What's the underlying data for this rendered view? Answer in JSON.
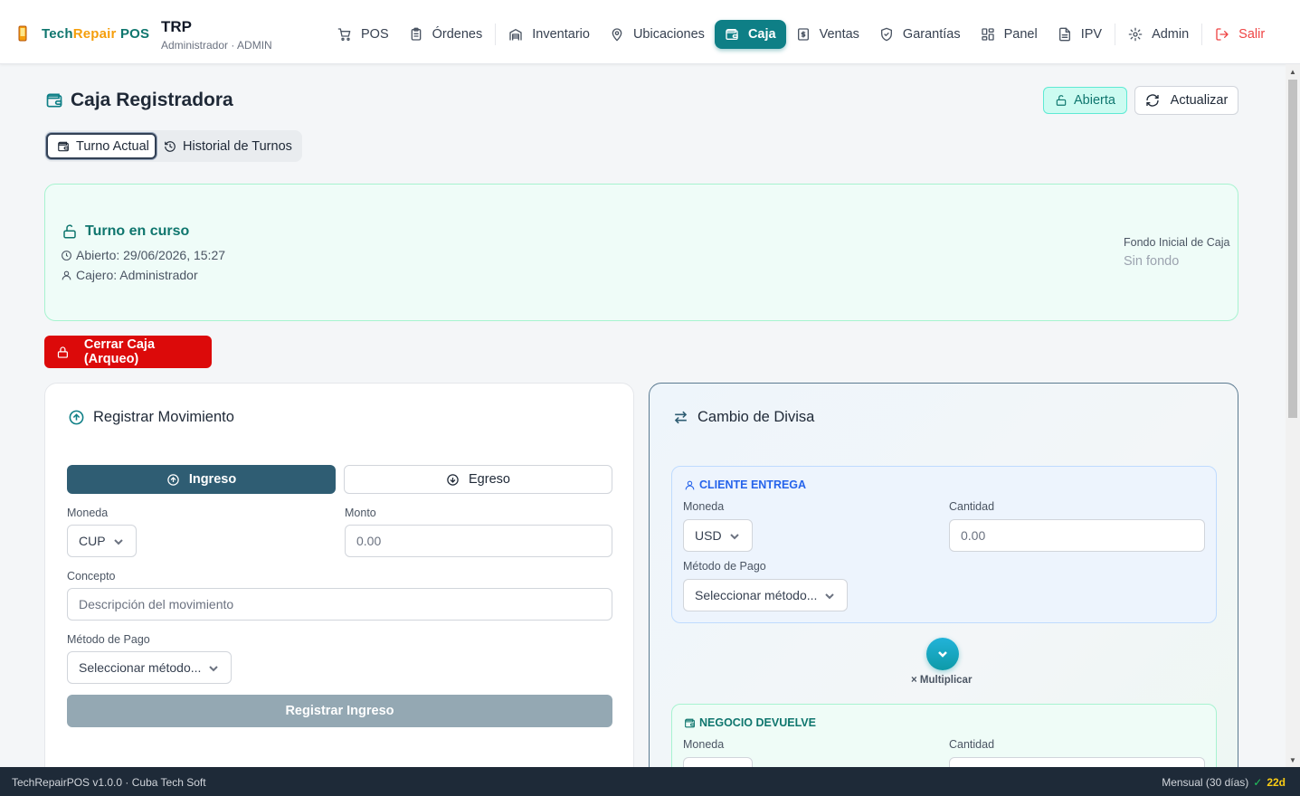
{
  "brand": {
    "name_prefix": "Tech",
    "name_accent": "Repair",
    "name_suffix": " POS",
    "store_code": "TRP",
    "user_line": "Administrador · ADMIN"
  },
  "nav": {
    "pos": "POS",
    "ordenes": "Órdenes",
    "inventario": "Inventario",
    "ubicaciones": "Ubicaciones",
    "caja": "Caja",
    "ventas": "Ventas",
    "garantias": "Garantías",
    "panel": "Panel",
    "ipv": "IPV",
    "admin": "Admin",
    "salir": "Salir"
  },
  "page": {
    "title": "Caja Registradora",
    "status": "Abierta",
    "refresh": "Actualizar"
  },
  "tabs": {
    "current": "Turno Actual",
    "history": "Historial de Turnos"
  },
  "shift": {
    "title": "Turno en curso",
    "opened": "Abierto: 29/06/2026, 15:27",
    "cashier": "Cajero: Administrador",
    "fund_label": "Fondo Inicial de Caja",
    "fund_value": "Sin fondo"
  },
  "close_button": "Cerrar Caja (Arqueo)",
  "movement": {
    "title": "Registrar Movimiento",
    "income": "Ingreso",
    "expense": "Egreso",
    "currency_label": "Moneda",
    "currency_value": "CUP",
    "amount_label": "Monto",
    "amount_placeholder": "0.00",
    "concept_label": "Concepto",
    "concept_placeholder": "Descripción del movimiento",
    "method_label": "Método de Pago",
    "method_placeholder": "Seleccionar método...",
    "submit": "Registrar Ingreso"
  },
  "exchange": {
    "title": "Cambio de Divisa",
    "client_title": "CLIENTE ENTREGA",
    "client_currency_label": "Moneda",
    "client_currency_value": "USD",
    "client_amount_label": "Cantidad",
    "client_amount_placeholder": "0.00",
    "client_method_label": "Método de Pago",
    "client_method_placeholder": "Seleccionar método...",
    "multiply_label": "× Multiplicar",
    "business_title": "NEGOCIO DEVUELVE",
    "business_currency_label": "Moneda",
    "business_amount_label": "Cantidad"
  },
  "footer": {
    "left": "TechRepairPOS v1.0.0 · Cuba Tech Soft",
    "plan": "Mensual (30 días)",
    "check": "✓",
    "days": "22d"
  },
  "colors": {
    "accent": "#0e7f86",
    "danger": "#dc0a0a",
    "income": "#2f5d73",
    "footer_bg": "#1e2a38"
  }
}
